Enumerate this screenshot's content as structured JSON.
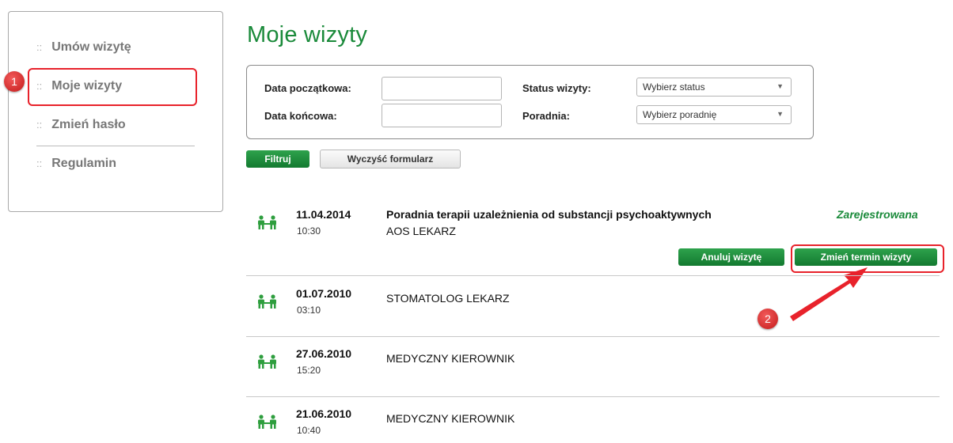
{
  "sidebar": {
    "items": [
      {
        "prefix": "::",
        "label": "Umów wizytę"
      },
      {
        "prefix": "::",
        "label": "Moje wizyty"
      },
      {
        "prefix": "::",
        "label": "Zmień hasło"
      },
      {
        "prefix": "::",
        "label": "Regulamin"
      }
    ]
  },
  "annotations": {
    "badge1": "1",
    "badge2": "2"
  },
  "page": {
    "title": "Moje wizyty"
  },
  "filter": {
    "start_date_label": "Data początkowa:",
    "start_date_value": "",
    "end_date_label": "Data końcowa:",
    "end_date_value": "",
    "status_label": "Status wizyty:",
    "status_value": "Wybierz status",
    "clinic_label": "Poradnia:",
    "clinic_value": "Wybierz poradnię"
  },
  "actions": {
    "filter_label": "Filtruj",
    "clear_label": "Wyczyść formularz"
  },
  "visits": [
    {
      "date": "11.04.2014",
      "time": "10:30",
      "title": "Poradnia terapii uzależnienia od substancji psychoaktywnych",
      "subtitle": "AOS LEKARZ",
      "status": "Zarejestrowana",
      "cancel_label": "Anuluj wizytę",
      "reschedule_label": "Zmień termin wizyty"
    },
    {
      "date": "01.07.2010",
      "time": "03:10",
      "title": "STOMATOLOG LEKARZ"
    },
    {
      "date": "27.06.2010",
      "time": "15:20",
      "title": "MEDYCZNY KIEROWNIK"
    },
    {
      "date": "21.06.2010",
      "time": "10:40",
      "title": "MEDYCZNY KIEROWNIK"
    }
  ],
  "colors": {
    "accent_green": "#1a8a3a",
    "highlight_red": "#e8222b",
    "icon_green": "#2e9e3e"
  }
}
